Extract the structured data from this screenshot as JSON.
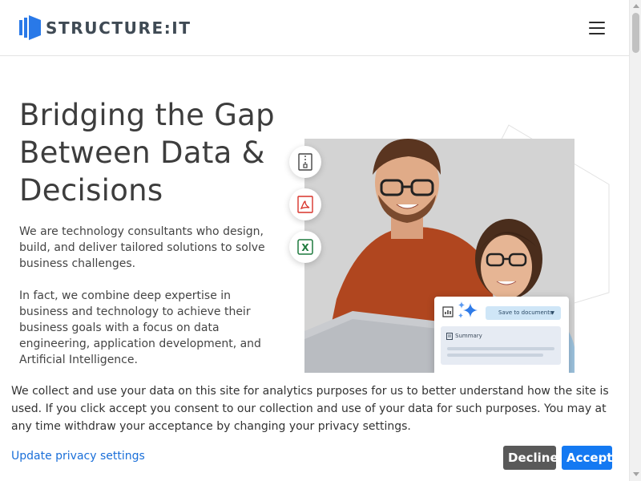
{
  "header": {
    "logo_text": "STRUCTURE:IT",
    "menu_icon": "hamburger-menu-icon",
    "brand_color": "#2979e8"
  },
  "hero": {
    "title_line1": "Bridging the Gap",
    "title_line2": "Between Data &",
    "title_line3": "Decisions",
    "paragraph1": "We are technology consultants who design, build, and deliver tailored solutions to solve business challenges.",
    "paragraph2": "In fact, we combine deep expertise in business and technology to achieve their business goals with a focus on data engineering, application development, and Artificial Intelligence."
  },
  "illustration": {
    "file_icons": [
      "zip-file-icon",
      "pdf-file-icon",
      "excel-file-icon"
    ],
    "doc_card": {
      "save_label": "Save to documents",
      "summary_label": "Summary"
    }
  },
  "cookie_banner": {
    "text": "We collect and use your data on this site for analytics purposes for us to better understand how the site is used. If you click accept you consent to our collection and use of your data for such purposes. You may at any time withdraw your acceptance by changing your privacy settings.",
    "settings_link": "Update privacy settings",
    "decline_label": "Decline",
    "accept_label": "Accept",
    "decline_color": "#595959",
    "accept_color": "#1479f2"
  }
}
